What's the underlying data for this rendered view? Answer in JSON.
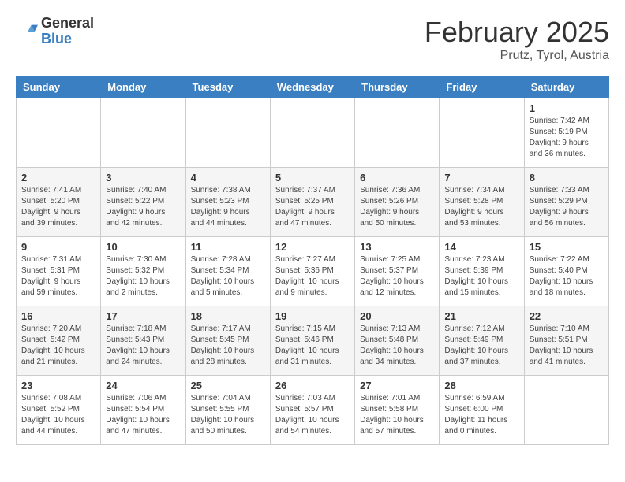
{
  "header": {
    "logo_general": "General",
    "logo_blue": "Blue",
    "month_title": "February 2025",
    "subtitle": "Prutz, Tyrol, Austria"
  },
  "weekdays": [
    "Sunday",
    "Monday",
    "Tuesday",
    "Wednesday",
    "Thursday",
    "Friday",
    "Saturday"
  ],
  "weeks": [
    [
      {
        "day": "",
        "info": ""
      },
      {
        "day": "",
        "info": ""
      },
      {
        "day": "",
        "info": ""
      },
      {
        "day": "",
        "info": ""
      },
      {
        "day": "",
        "info": ""
      },
      {
        "day": "",
        "info": ""
      },
      {
        "day": "1",
        "info": "Sunrise: 7:42 AM\nSunset: 5:19 PM\nDaylight: 9 hours and 36 minutes."
      }
    ],
    [
      {
        "day": "2",
        "info": "Sunrise: 7:41 AM\nSunset: 5:20 PM\nDaylight: 9 hours and 39 minutes."
      },
      {
        "day": "3",
        "info": "Sunrise: 7:40 AM\nSunset: 5:22 PM\nDaylight: 9 hours and 42 minutes."
      },
      {
        "day": "4",
        "info": "Sunrise: 7:38 AM\nSunset: 5:23 PM\nDaylight: 9 hours and 44 minutes."
      },
      {
        "day": "5",
        "info": "Sunrise: 7:37 AM\nSunset: 5:25 PM\nDaylight: 9 hours and 47 minutes."
      },
      {
        "day": "6",
        "info": "Sunrise: 7:36 AM\nSunset: 5:26 PM\nDaylight: 9 hours and 50 minutes."
      },
      {
        "day": "7",
        "info": "Sunrise: 7:34 AM\nSunset: 5:28 PM\nDaylight: 9 hours and 53 minutes."
      },
      {
        "day": "8",
        "info": "Sunrise: 7:33 AM\nSunset: 5:29 PM\nDaylight: 9 hours and 56 minutes."
      }
    ],
    [
      {
        "day": "9",
        "info": "Sunrise: 7:31 AM\nSunset: 5:31 PM\nDaylight: 9 hours and 59 minutes."
      },
      {
        "day": "10",
        "info": "Sunrise: 7:30 AM\nSunset: 5:32 PM\nDaylight: 10 hours and 2 minutes."
      },
      {
        "day": "11",
        "info": "Sunrise: 7:28 AM\nSunset: 5:34 PM\nDaylight: 10 hours and 5 minutes."
      },
      {
        "day": "12",
        "info": "Sunrise: 7:27 AM\nSunset: 5:36 PM\nDaylight: 10 hours and 9 minutes."
      },
      {
        "day": "13",
        "info": "Sunrise: 7:25 AM\nSunset: 5:37 PM\nDaylight: 10 hours and 12 minutes."
      },
      {
        "day": "14",
        "info": "Sunrise: 7:23 AM\nSunset: 5:39 PM\nDaylight: 10 hours and 15 minutes."
      },
      {
        "day": "15",
        "info": "Sunrise: 7:22 AM\nSunset: 5:40 PM\nDaylight: 10 hours and 18 minutes."
      }
    ],
    [
      {
        "day": "16",
        "info": "Sunrise: 7:20 AM\nSunset: 5:42 PM\nDaylight: 10 hours and 21 minutes."
      },
      {
        "day": "17",
        "info": "Sunrise: 7:18 AM\nSunset: 5:43 PM\nDaylight: 10 hours and 24 minutes."
      },
      {
        "day": "18",
        "info": "Sunrise: 7:17 AM\nSunset: 5:45 PM\nDaylight: 10 hours and 28 minutes."
      },
      {
        "day": "19",
        "info": "Sunrise: 7:15 AM\nSunset: 5:46 PM\nDaylight: 10 hours and 31 minutes."
      },
      {
        "day": "20",
        "info": "Sunrise: 7:13 AM\nSunset: 5:48 PM\nDaylight: 10 hours and 34 minutes."
      },
      {
        "day": "21",
        "info": "Sunrise: 7:12 AM\nSunset: 5:49 PM\nDaylight: 10 hours and 37 minutes."
      },
      {
        "day": "22",
        "info": "Sunrise: 7:10 AM\nSunset: 5:51 PM\nDaylight: 10 hours and 41 minutes."
      }
    ],
    [
      {
        "day": "23",
        "info": "Sunrise: 7:08 AM\nSunset: 5:52 PM\nDaylight: 10 hours and 44 minutes."
      },
      {
        "day": "24",
        "info": "Sunrise: 7:06 AM\nSunset: 5:54 PM\nDaylight: 10 hours and 47 minutes."
      },
      {
        "day": "25",
        "info": "Sunrise: 7:04 AM\nSunset: 5:55 PM\nDaylight: 10 hours and 50 minutes."
      },
      {
        "day": "26",
        "info": "Sunrise: 7:03 AM\nSunset: 5:57 PM\nDaylight: 10 hours and 54 minutes."
      },
      {
        "day": "27",
        "info": "Sunrise: 7:01 AM\nSunset: 5:58 PM\nDaylight: 10 hours and 57 minutes."
      },
      {
        "day": "28",
        "info": "Sunrise: 6:59 AM\nSunset: 6:00 PM\nDaylight: 11 hours and 0 minutes."
      },
      {
        "day": "",
        "info": ""
      }
    ]
  ]
}
